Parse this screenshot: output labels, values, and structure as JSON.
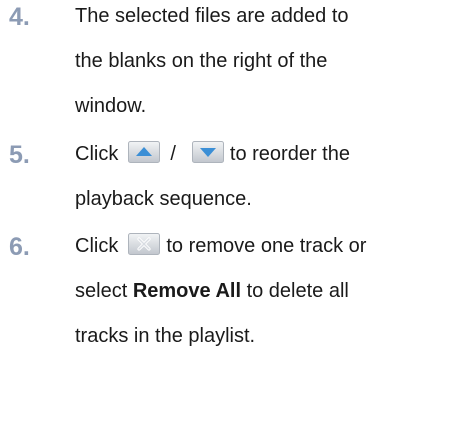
{
  "steps": [
    {
      "number": "4.",
      "lines": [
        "The selected files are added to",
        "the blanks on the right of the",
        "window."
      ]
    },
    {
      "number": "5.",
      "line1": {
        "prefix": "Click",
        "separator": "/",
        "suffix": "to reorder the",
        "icons": [
          "move-up-icon",
          "move-down-icon"
        ]
      },
      "line2": "playback sequence."
    },
    {
      "number": "6.",
      "line1": {
        "prefix": "Click",
        "suffix": "to remove one track or",
        "icon": "remove-track-icon"
      },
      "line2": {
        "prefix": "select",
        "bold": "Remove All",
        "suffix": "to delete all"
      },
      "line3": "tracks in the playlist."
    }
  ],
  "colors": {
    "step_number": "#8c9bb4",
    "icon_blue": "#3b8fd6",
    "icon_gray": "#c7ccd3"
  }
}
